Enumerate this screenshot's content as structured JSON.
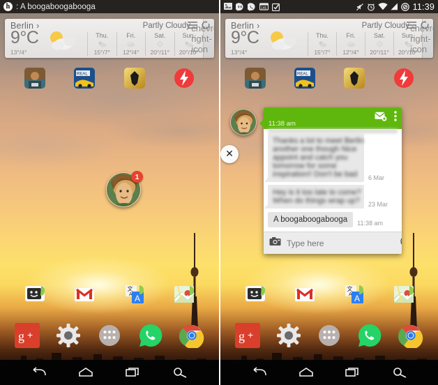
{
  "meta": {
    "accent_green": "#5fb70d",
    "badge_red": "#e8432f",
    "status_bg": "rgba(0,0,0,0.74)"
  },
  "left_phone": {
    "statusbar": {
      "ticker_text": ": A boogaboogabooga",
      "ticker_icon": "hangouts-icon"
    },
    "chathead": {
      "badge_count": "1",
      "avatar": "contact-avatar"
    }
  },
  "right_phone": {
    "statusbar": {
      "left_icons": [
        "screenshot-icon",
        "hangouts-icon",
        "hangouts-dialer-icon",
        "calendar-icon",
        "tasks-icon"
      ],
      "calendar_day": "145",
      "right_icons": [
        "vibrate-mute-icon",
        "alarm-icon",
        "wifi-icon",
        "signal-icon",
        "do-not-disturb-icon"
      ],
      "clock": "11:39"
    },
    "chat": {
      "header_time": "11:38 am",
      "new_message_icon": "new-message-icon",
      "overflow_icon": "overflow-menu-icon",
      "close_icon": "close-icon",
      "avatar": "contact-avatar",
      "messages": [
        {
          "id": "msg1",
          "redacted": true,
          "lines": [
            "Thanks a lot to meet Berlin",
            "another one though Nice",
            "appoint and catch you",
            "tomorrow for some",
            "inspiration!! Don't be bad"
          ],
          "timestamp": "6 Mar",
          "side": "in"
        },
        {
          "id": "msg2",
          "redacted": true,
          "lines": [
            "Hey is it too late to come?",
            "When do things wrap up?"
          ],
          "timestamp": "23 Mar",
          "side": "in"
        },
        {
          "id": "msg3",
          "redacted": false,
          "text": "A boogaboogabooga",
          "timestamp": "11:38 am",
          "side": "in"
        }
      ],
      "composer": {
        "camera_icon": "camera-icon",
        "placeholder": "Type here",
        "value": "",
        "emoji_icon": "emoji-icon",
        "send_icon": "send-icon"
      }
    }
  },
  "weather": {
    "city": "Berlin",
    "city_chevron": "›",
    "temp": "9°C",
    "hilo": "13°/4°",
    "condition": "Partly Cloudy",
    "list_icon": "list-icon",
    "refresh_icon": "refresh-icon",
    "next_icon": "chevron-right-icon",
    "forecast": [
      {
        "day": "Thu.",
        "icon": "partly-cloudy-icon",
        "temps": "15°/7°"
      },
      {
        "day": "Fri.",
        "icon": "cloudy-icon",
        "temps": "12°/4°"
      },
      {
        "day": "Sat.",
        "icon": "sunny-icon",
        "temps": "20°/11°"
      },
      {
        "day": "Sun.",
        "icon": "partly-cloudy-icon",
        "temps": "20°/10°"
      }
    ]
  },
  "home": {
    "row1": [
      {
        "name": "shooter-game-icon",
        "label": "Shooter Game"
      },
      {
        "name": "real-racing-icon",
        "label": "Real Racing 3"
      },
      {
        "name": "transformers-icon",
        "label": "Transformers"
      },
      {
        "name": "flash-boost-icon",
        "label": "Boost"
      }
    ],
    "row2": [
      {
        "name": "messaging-icon",
        "label": "Messaging"
      },
      {
        "name": "gmail-icon",
        "label": "Gmail"
      },
      {
        "name": "translate-icon",
        "label": "Translate"
      },
      {
        "name": "maps-icon",
        "label": "Maps"
      }
    ],
    "dock": [
      {
        "name": "google-plus-icon",
        "label": "Google+"
      },
      {
        "name": "settings-icon",
        "label": "Settings"
      },
      {
        "name": "app-drawer-icon",
        "label": "Apps"
      },
      {
        "name": "whatsapp-icon",
        "label": "WhatsApp"
      },
      {
        "name": "chrome-icon",
        "label": "Chrome"
      }
    ]
  },
  "navbar": [
    {
      "name": "back-button",
      "label": "Back"
    },
    {
      "name": "home-button",
      "label": "Home"
    },
    {
      "name": "recents-button",
      "label": "Recent apps"
    },
    {
      "name": "search-button",
      "label": "Search"
    }
  ]
}
